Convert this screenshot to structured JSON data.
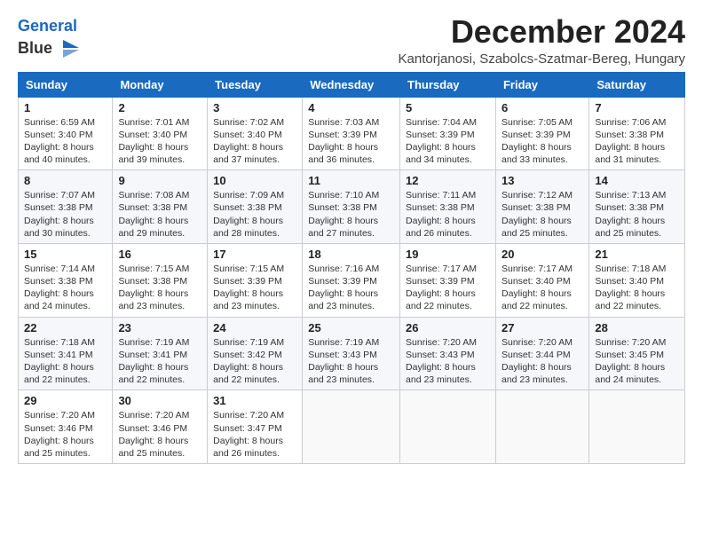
{
  "logo": {
    "line1": "General",
    "line2": "Blue"
  },
  "title": "December 2024",
  "subtitle": "Kantorjanosi, Szabolcs-Szatmar-Bereg, Hungary",
  "days": [
    "Sunday",
    "Monday",
    "Tuesday",
    "Wednesday",
    "Thursday",
    "Friday",
    "Saturday"
  ],
  "weeks": [
    [
      {
        "day": "1",
        "rise": "6:59 AM",
        "set": "3:40 PM",
        "daylight": "8 hours and 40 minutes."
      },
      {
        "day": "2",
        "rise": "7:01 AM",
        "set": "3:40 PM",
        "daylight": "8 hours and 39 minutes."
      },
      {
        "day": "3",
        "rise": "7:02 AM",
        "set": "3:40 PM",
        "daylight": "8 hours and 37 minutes."
      },
      {
        "day": "4",
        "rise": "7:03 AM",
        "set": "3:39 PM",
        "daylight": "8 hours and 36 minutes."
      },
      {
        "day": "5",
        "rise": "7:04 AM",
        "set": "3:39 PM",
        "daylight": "8 hours and 34 minutes."
      },
      {
        "day": "6",
        "rise": "7:05 AM",
        "set": "3:39 PM",
        "daylight": "8 hours and 33 minutes."
      },
      {
        "day": "7",
        "rise": "7:06 AM",
        "set": "3:38 PM",
        "daylight": "8 hours and 31 minutes."
      }
    ],
    [
      {
        "day": "8",
        "rise": "7:07 AM",
        "set": "3:38 PM",
        "daylight": "8 hours and 30 minutes."
      },
      {
        "day": "9",
        "rise": "7:08 AM",
        "set": "3:38 PM",
        "daylight": "8 hours and 29 minutes."
      },
      {
        "day": "10",
        "rise": "7:09 AM",
        "set": "3:38 PM",
        "daylight": "8 hours and 28 minutes."
      },
      {
        "day": "11",
        "rise": "7:10 AM",
        "set": "3:38 PM",
        "daylight": "8 hours and 27 minutes."
      },
      {
        "day": "12",
        "rise": "7:11 AM",
        "set": "3:38 PM",
        "daylight": "8 hours and 26 minutes."
      },
      {
        "day": "13",
        "rise": "7:12 AM",
        "set": "3:38 PM",
        "daylight": "8 hours and 25 minutes."
      },
      {
        "day": "14",
        "rise": "7:13 AM",
        "set": "3:38 PM",
        "daylight": "8 hours and 25 minutes."
      }
    ],
    [
      {
        "day": "15",
        "rise": "7:14 AM",
        "set": "3:38 PM",
        "daylight": "8 hours and 24 minutes."
      },
      {
        "day": "16",
        "rise": "7:15 AM",
        "set": "3:38 PM",
        "daylight": "8 hours and 23 minutes."
      },
      {
        "day": "17",
        "rise": "7:15 AM",
        "set": "3:39 PM",
        "daylight": "8 hours and 23 minutes."
      },
      {
        "day": "18",
        "rise": "7:16 AM",
        "set": "3:39 PM",
        "daylight": "8 hours and 23 minutes."
      },
      {
        "day": "19",
        "rise": "7:17 AM",
        "set": "3:39 PM",
        "daylight": "8 hours and 22 minutes."
      },
      {
        "day": "20",
        "rise": "7:17 AM",
        "set": "3:40 PM",
        "daylight": "8 hours and 22 minutes."
      },
      {
        "day": "21",
        "rise": "7:18 AM",
        "set": "3:40 PM",
        "daylight": "8 hours and 22 minutes."
      }
    ],
    [
      {
        "day": "22",
        "rise": "7:18 AM",
        "set": "3:41 PM",
        "daylight": "8 hours and 22 minutes."
      },
      {
        "day": "23",
        "rise": "7:19 AM",
        "set": "3:41 PM",
        "daylight": "8 hours and 22 minutes."
      },
      {
        "day": "24",
        "rise": "7:19 AM",
        "set": "3:42 PM",
        "daylight": "8 hours and 22 minutes."
      },
      {
        "day": "25",
        "rise": "7:19 AM",
        "set": "3:43 PM",
        "daylight": "8 hours and 23 minutes."
      },
      {
        "day": "26",
        "rise": "7:20 AM",
        "set": "3:43 PM",
        "daylight": "8 hours and 23 minutes."
      },
      {
        "day": "27",
        "rise": "7:20 AM",
        "set": "3:44 PM",
        "daylight": "8 hours and 23 minutes."
      },
      {
        "day": "28",
        "rise": "7:20 AM",
        "set": "3:45 PM",
        "daylight": "8 hours and 24 minutes."
      }
    ],
    [
      {
        "day": "29",
        "rise": "7:20 AM",
        "set": "3:46 PM",
        "daylight": "8 hours and 25 minutes."
      },
      {
        "day": "30",
        "rise": "7:20 AM",
        "set": "3:46 PM",
        "daylight": "8 hours and 25 minutes."
      },
      {
        "day": "31",
        "rise": "7:20 AM",
        "set": "3:47 PM",
        "daylight": "8 hours and 26 minutes."
      },
      null,
      null,
      null,
      null
    ]
  ]
}
